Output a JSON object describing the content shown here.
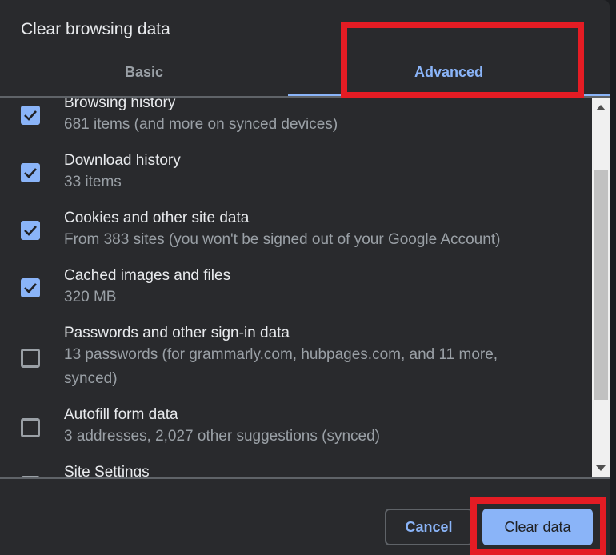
{
  "dialog": {
    "title": "Clear browsing data",
    "tabs": [
      {
        "label": "Basic",
        "active": false
      },
      {
        "label": "Advanced",
        "active": true
      }
    ],
    "items": [
      {
        "label": "Browsing history",
        "description": "681 items (and more on synced devices)",
        "checked": true
      },
      {
        "label": "Download history",
        "description": "33 items",
        "checked": true
      },
      {
        "label": "Cookies and other site data",
        "description": "From 383 sites (you won't be signed out of your Google Account)",
        "checked": true
      },
      {
        "label": "Cached images and files",
        "description": "320 MB",
        "checked": true
      },
      {
        "label": "Passwords and other sign-in data",
        "description": "13 passwords (for grammarly.com, hubpages.com, and 11 more, synced)",
        "checked": false
      },
      {
        "label": "Autofill form data",
        "description": "3 addresses, 2,027 other suggestions (synced)",
        "checked": false
      },
      {
        "label": "Site Settings",
        "description": "",
        "checked": false
      }
    ],
    "buttons": {
      "cancel": "Cancel",
      "clear": "Clear data"
    }
  },
  "colors": {
    "accent": "#8ab4f8",
    "background": "#292a2d",
    "highlight": "#e41c24"
  }
}
